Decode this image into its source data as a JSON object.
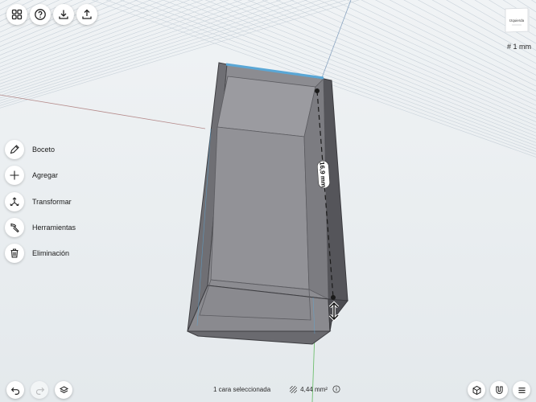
{
  "top_toolbar": {
    "buttons": [
      "grid-menu",
      "help",
      "import",
      "export"
    ]
  },
  "scale_label": "# 1 mm",
  "viewcube": {
    "face_label": "Izquierda"
  },
  "tools": [
    {
      "id": "sketch",
      "label": "Boceto",
      "icon": "pencil-icon"
    },
    {
      "id": "add",
      "label": "Agregar",
      "icon": "plus-icon"
    },
    {
      "id": "transform",
      "label": "Transformar",
      "icon": "transform-icon"
    },
    {
      "id": "tools",
      "label": "Herramientas",
      "icon": "hammer-icon"
    },
    {
      "id": "delete",
      "label": "Eliminación",
      "icon": "trash-icon"
    }
  ],
  "dimension_label": "16,9 mm",
  "status": {
    "selection": "1 cara seleccionada",
    "area": "4,44 mm²"
  },
  "colors": {
    "background": "#e9edf0",
    "grid": "#c9d2da",
    "model_fill": "#8a8a8f",
    "model_dark": "#4d4d52",
    "selection": "#5aa7d6"
  }
}
